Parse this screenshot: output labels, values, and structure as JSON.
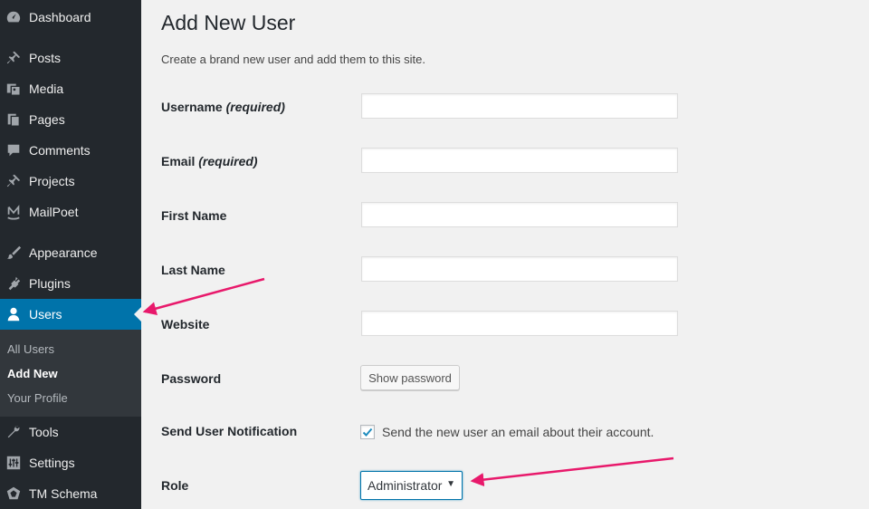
{
  "sidebar": {
    "items": [
      {
        "label": "Dashboard",
        "icon": "dashboard-icon"
      },
      {
        "label": "Posts",
        "icon": "pin-icon"
      },
      {
        "label": "Media",
        "icon": "media-icon"
      },
      {
        "label": "Pages",
        "icon": "pages-icon"
      },
      {
        "label": "Comments",
        "icon": "comment-icon"
      },
      {
        "label": "Projects",
        "icon": "pin-icon"
      },
      {
        "label": "MailPoet",
        "icon": "mailpoet-icon"
      },
      {
        "label": "Appearance",
        "icon": "paintbrush-icon"
      },
      {
        "label": "Plugins",
        "icon": "plugin-icon"
      },
      {
        "label": "Users",
        "icon": "user-icon"
      },
      {
        "label": "Tools",
        "icon": "wrench-icon"
      },
      {
        "label": "Settings",
        "icon": "settings-icon"
      },
      {
        "label": "TM Schema",
        "icon": "schema-icon"
      }
    ],
    "active": "Users",
    "submenu": [
      "All Users",
      "Add New",
      "Your Profile"
    ],
    "submenu_current": "Add New"
  },
  "main": {
    "title": "Add New User",
    "description": "Create a brand new user and add them to this site.",
    "fields": {
      "username": {
        "label": "Username",
        "required": "(required)",
        "value": ""
      },
      "email": {
        "label": "Email",
        "required": "(required)",
        "value": ""
      },
      "first_name": {
        "label": "First Name",
        "value": ""
      },
      "last_name": {
        "label": "Last Name",
        "value": ""
      },
      "website": {
        "label": "Website",
        "value": ""
      },
      "password": {
        "label": "Password",
        "button_label": "Show password"
      },
      "notification": {
        "label": "Send User Notification",
        "checkbox_label": "Send the new user an email about their account.",
        "checked": true
      },
      "role": {
        "label": "Role",
        "selected": "Administrator"
      }
    }
  },
  "colors": {
    "sidebar_bg": "#23282d",
    "active_bg": "#0073aa",
    "annotation_arrow": "#e8196b"
  }
}
